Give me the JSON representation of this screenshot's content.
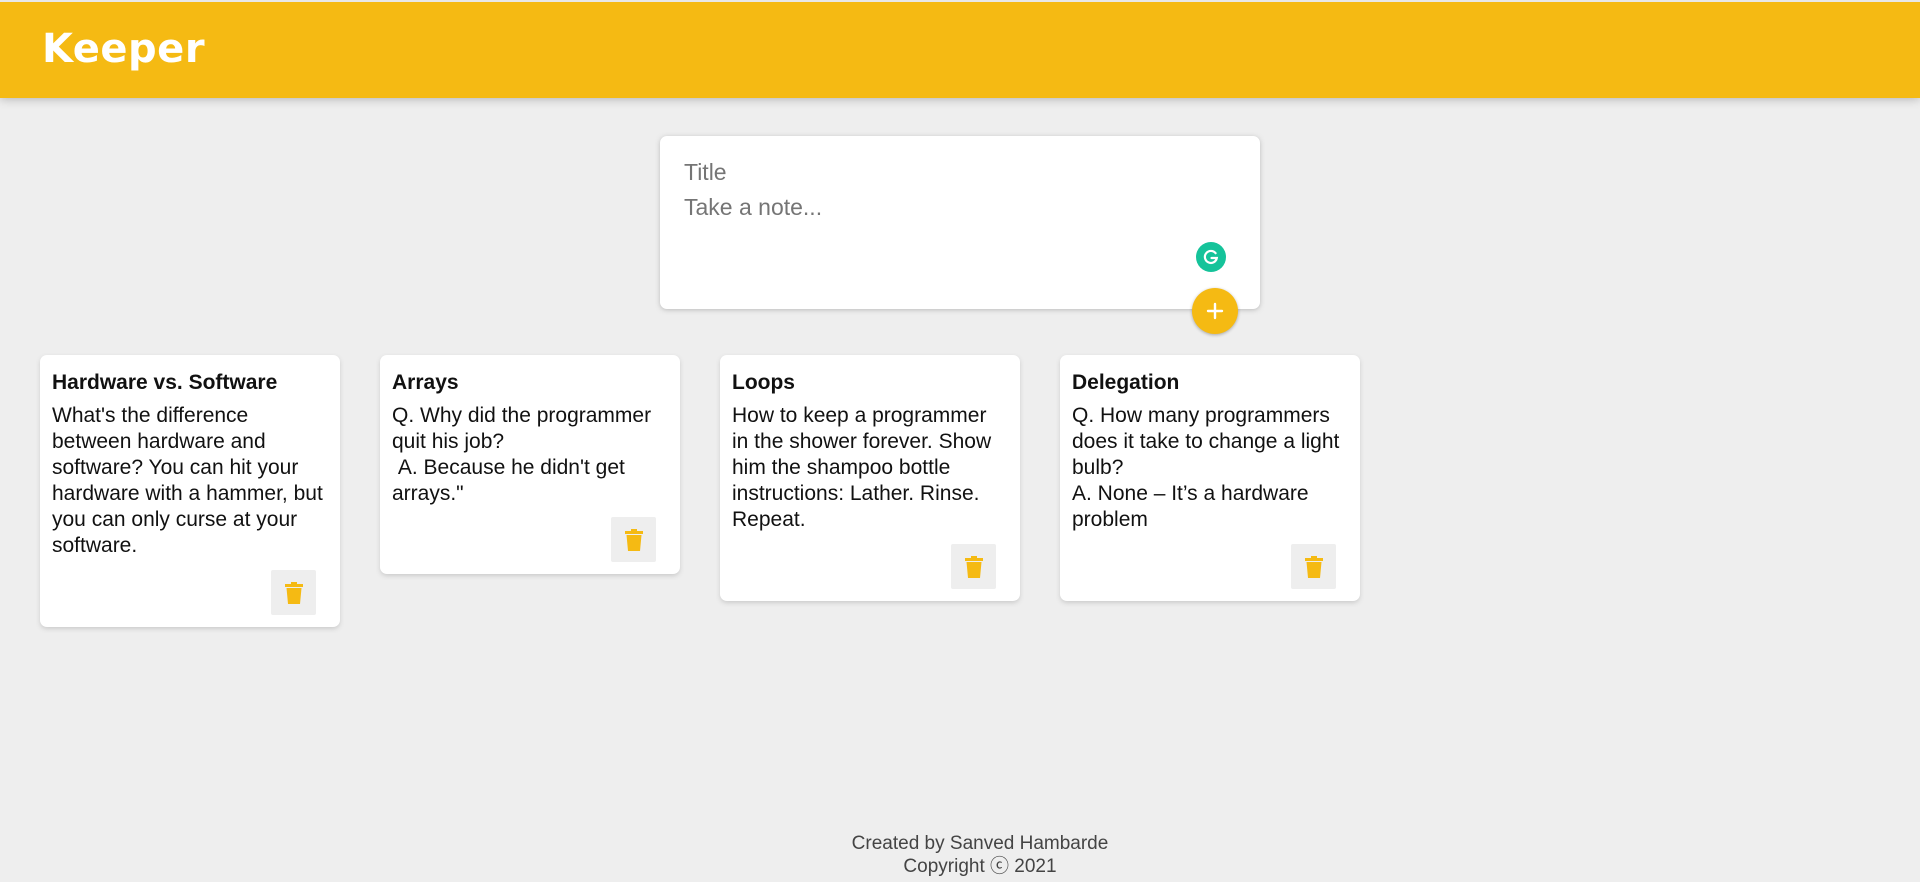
{
  "header": {
    "title": "Keeper"
  },
  "create_note": {
    "title_placeholder": "Title",
    "content_placeholder": "Take a note...",
    "add_icon": "plus-icon",
    "grammarly_icon": "grammarly-icon"
  },
  "notes": [
    {
      "title": "Hardware vs. Software",
      "content": "What's the difference between hardware and software? You can hit your hardware with a hammer, but you can only curse at your software."
    },
    {
      "title": "Arrays",
      "content": "Q. Why did the programmer quit his job?\n A. Because he didn't get arrays.\""
    },
    {
      "title": "Loops",
      "content": "How to keep a programmer in the shower forever. Show him the shampoo bottle instructions: Lather. Rinse. Repeat."
    },
    {
      "title": "Delegation",
      "content": "Q. How many programmers does it take to change a light bulb?\nA. None – It’s a hardware problem"
    }
  ],
  "delete_icon": "trash-icon",
  "footer": {
    "credit": "Created by Sanved Hambarde",
    "copyright": "Copyright ⓒ 2021"
  },
  "colors": {
    "accent": "#f5ba13",
    "background": "#eeeeee",
    "grammarly": "#15c39a"
  }
}
